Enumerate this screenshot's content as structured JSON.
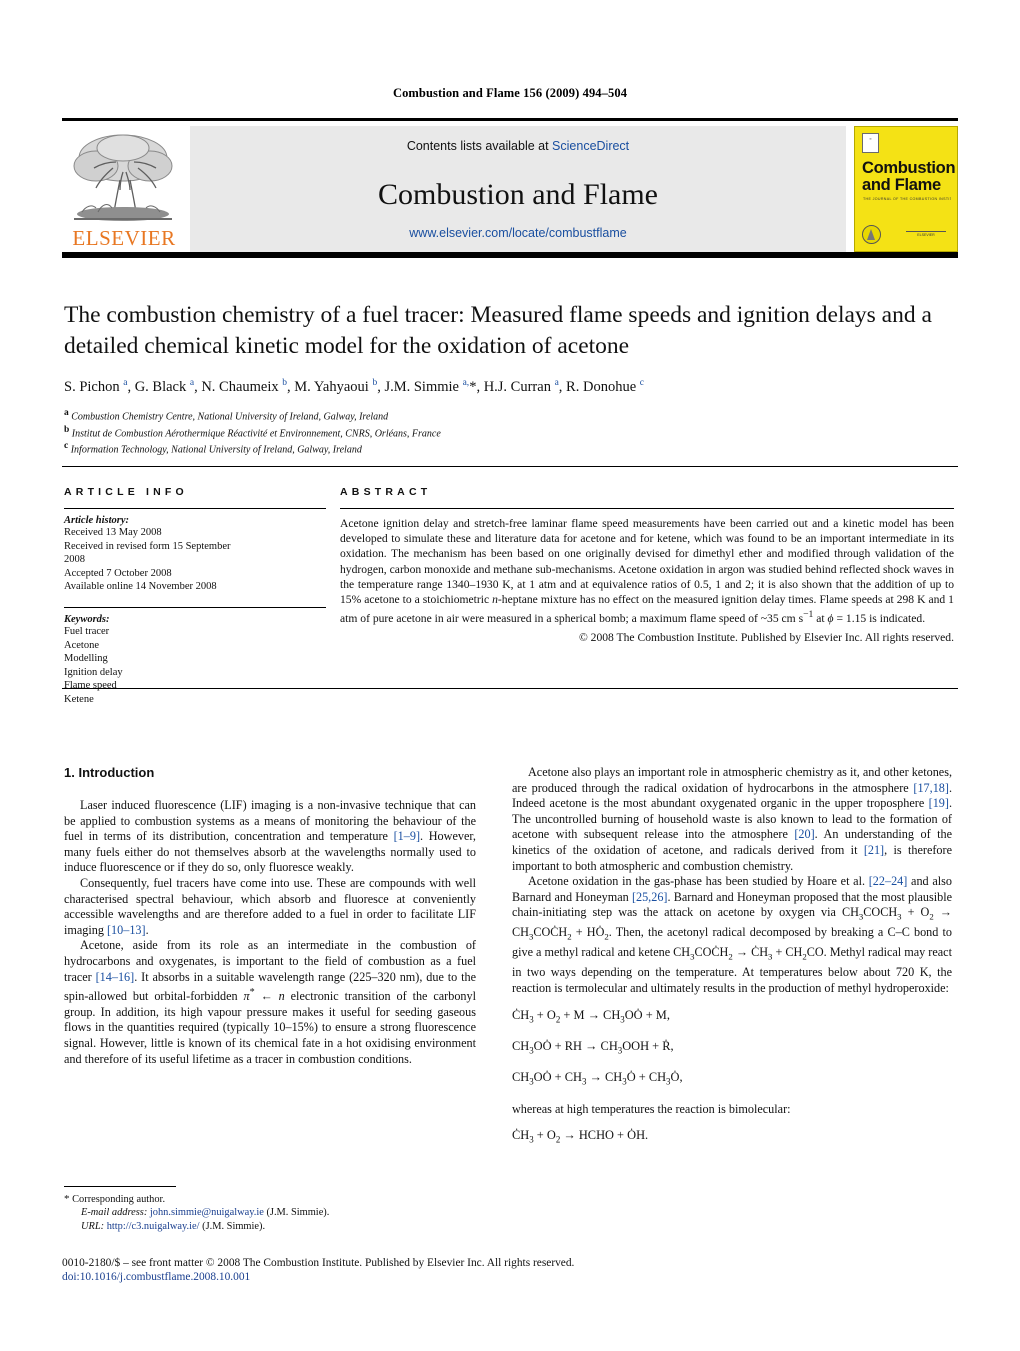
{
  "running_head": "Combustion and Flame 156 (2009) 494–504",
  "masthead": {
    "publisher_name": "ELSEVIER",
    "contents_prefix": "Contents lists available at ",
    "contents_link": "ScienceDirect",
    "journal_title": "Combustion and Flame",
    "journal_url": "www.elsevier.com/locate/combustflame",
    "cover": {
      "title_line1": "Combustion",
      "title_line2": "and Flame",
      "subtitle": "THE JOURNAL OF THE COMBUSTION INSTITUTE",
      "brand_mark": "ELSEVIER"
    }
  },
  "article": {
    "title": "The combustion chemistry of a fuel tracer: Measured flame speeds and ignition delays and a detailed chemical kinetic model for the oxidation of acetone",
    "authors_html": "S. Pichon <sup>a</sup>, G. Black <sup>a</sup>, N. Chaumeix <sup>b</sup>, M. Yahyaoui <sup>b</sup>, J.M. Simmie <sup>a,</sup><span class=\"star\">*</span>, H.J. Curran <sup>a</sup>, R. Donohue <sup>c</sup>",
    "affiliations": [
      {
        "mark": "a",
        "text": "Combustion Chemistry Centre, National University of Ireland, Galway, Ireland"
      },
      {
        "mark": "b",
        "text": "Institut de Combustion Aérothermique Réactivité et Environnement, CNRS, Orléans, France"
      },
      {
        "mark": "c",
        "text": "Information Technology, National University of Ireland, Galway, Ireland"
      }
    ]
  },
  "article_info": {
    "heading": "ARTICLE INFO",
    "history_label": "Article history:",
    "history": [
      "Received 13 May 2008",
      "Received in revised form 15 September",
      "2008",
      "Accepted 7 October 2008",
      "Available online 14 November 2008"
    ],
    "keywords_label": "Keywords:",
    "keywords": [
      "Fuel tracer",
      "Acetone",
      "Modelling",
      "Ignition delay",
      "Flame speed",
      "Ketene"
    ]
  },
  "abstract": {
    "heading": "ABSTRACT",
    "text_html": "Acetone ignition delay and stretch-free laminar flame speed measurements have been carried out and a kinetic model has been developed to simulate these and literature data for acetone and for ketene, which was found to be an important intermediate in its oxidation. The mechanism has been based on one originally devised for dimethyl ether and modified through validation of the hydrogen, carbon monoxide and methane sub-mechanisms. Acetone oxidation in argon was studied behind reflected shock waves in the temperature range 1340–1930 K, at 1 atm and at equivalence ratios of 0.5, 1 and 2; it is also shown that the addition of up to 15% acetone to a stoichiometric <i>n</i>-heptane mixture has no effect on the measured ignition delay times. Flame speeds at 298 K and 1 atm of pure acetone in air were measured in a spherical bomb; a maximum flame speed of ~35 cm s<sup>−1</sup> at <i>ϕ</i> = 1.15 is indicated.",
    "copyright": "© 2008 The Combustion Institute. Published by Elsevier Inc. All rights reserved."
  },
  "body": {
    "section_heading": "1. Introduction",
    "left_paragraphs_html": [
      "Laser induced fluorescence (LIF) imaging is a non-invasive technique that can be applied to combustion systems as a means of monitoring the behaviour of the fuel in terms of its distribution, concentration and temperature <span class=\"cite\">[1–9]</span>. However, many fuels either do not themselves absorb at the wavelengths normally used to induce fluorescence or if they do so, only fluoresce weakly.",
      "Consequently, fuel tracers have come into use. These are compounds with well characterised spectral behaviour, which absorb and fluoresce at conveniently accessible wavelengths and are therefore added to a fuel in order to facilitate LIF imaging <span class=\"cite\">[10–13]</span>.",
      "Acetone, aside from its role as an intermediate in the combustion of hydrocarbons and oxygenates, is important to the field of combustion as a fuel tracer <span class=\"cite\">[14–16]</span>. It absorbs in a suitable wavelength range (225–320 nm), due to the spin-allowed but orbital-forbidden <i>π</i><sup>*</sup> ← <i>n</i> electronic transition of the carbonyl group. In addition, its high vapour pressure makes it useful for seeding gaseous flows in the quantities required (typically 10–15%) to ensure a strong fluorescence signal. However, little is known of its chemical fate in a hot oxidising environment and therefore of its useful lifetime as a tracer in combustion conditions."
    ],
    "right_paragraphs_html": [
      "Acetone also plays an important role in atmospheric chemistry as it, and other ketones, are produced through the radical oxidation of hydrocarbons in the atmosphere <span class=\"cite\">[17,18]</span>. Indeed acetone is the most abundant oxygenated organic in the upper troposphere <span class=\"cite\">[19]</span>. The uncontrolled burning of household waste is also known to lead to the formation of acetone with subsequent release into the atmosphere <span class=\"cite\">[20]</span>. An understanding of the kinetics of the oxidation of acetone, and radicals derived from it <span class=\"cite\">[21]</span>, is therefore important to both atmospheric and combustion chemistry.",
      "Acetone oxidation in the gas-phase has been studied by Hoare et al. <span class=\"cite\">[22–24]</span> and also Barnard and Honeyman <span class=\"cite\">[25,26]</span>. Barnard and Honeyman proposed that the most plausible chain-initiating step was the attack on acetone by oxygen via CH<sub>3</sub>COCH<sub>3</sub> + O<sub>2</sub> → CH<sub>3</sub>COĊH<sub>2</sub> + HȮ<sub>2</sub>. Then, the acetonyl radical decomposed by breaking a C–C bond to give a methyl radical and ketene CH<sub>3</sub>COĊH<sub>2</sub> → ĊH<sub>3</sub> + CH<sub>2</sub>CO. Methyl radical may react in two ways depending on the temperature. At temperatures below about 720 K, the reaction is termolecular and ultimately results in the production of methyl hydroperoxide:"
    ],
    "equations_html": [
      "ĊH<sub>3</sub> + O<sub>2</sub> + M → CH<sub>3</sub>OȮ + M,",
      "CH<sub>3</sub>OȮ + RH → CH<sub>3</sub>OOH + Ṙ,",
      "CH<sub>3</sub>OȮ + CH<sub>3</sub> → CH<sub>3</sub>Ȯ + CH<sub>3</sub>Ȯ,"
    ],
    "equation_note": "whereas at high temperatures the reaction is bimolecular:",
    "final_equation_html": "ĊH<sub>3</sub> + O<sub>2</sub> → HCHO + ȮH."
  },
  "footnote": {
    "star": "*",
    "corresponding": "Corresponding author.",
    "email_label": "E-mail address:",
    "email": "john.simmie@nuigalway.ie",
    "email_owner": "(J.M. Simmie).",
    "url_label": "URL:",
    "url": "http://c3.nuigalway.ie/",
    "url_owner": "(J.M. Simmie)."
  },
  "page_footer": {
    "front_matter": "0010-2180/$ – see front matter © 2008 The Combustion Institute. Published by Elsevier Inc. All rights reserved.",
    "doi": "doi:10.1016/j.combustflame.2008.10.001"
  },
  "colors": {
    "link": "#1a4fa0",
    "elsevier_orange": "#E87722",
    "cover_yellow": "#f4e215",
    "banner_gray": "#e9e9e9"
  }
}
